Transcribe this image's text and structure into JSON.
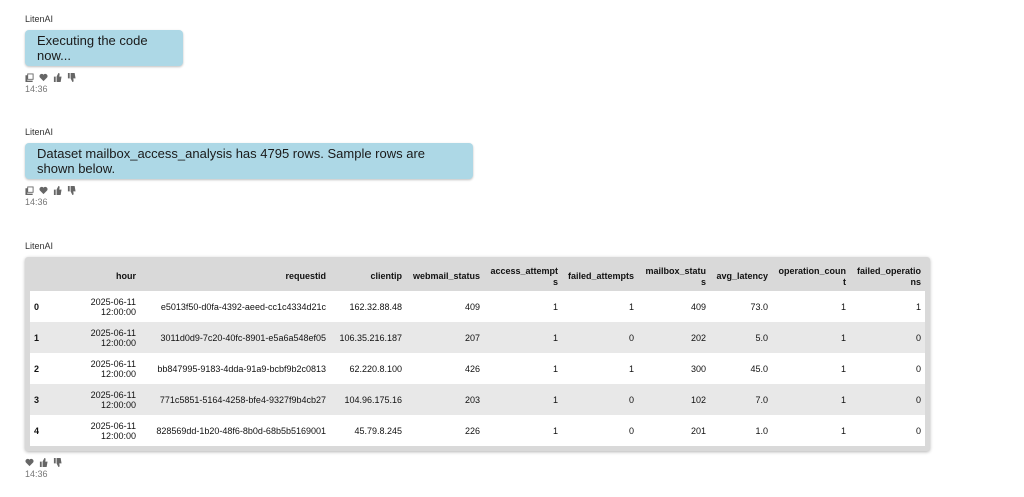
{
  "messages": [
    {
      "sender": "LitenAI",
      "text": "Executing the code now...",
      "time": "14:36"
    },
    {
      "sender": "LitenAI",
      "text": "Dataset mailbox_access_analysis has 4795 rows. Sample rows are shown below.",
      "time": "14:36"
    },
    {
      "sender": "LitenAI",
      "time": "14:36"
    }
  ],
  "table": {
    "columns": [
      "",
      "hour",
      "requestid",
      "clientip",
      "webmail_status",
      "access_attempts",
      "failed_attempts",
      "mailbox_status",
      "avg_latency",
      "operation_count",
      "failed_operations"
    ],
    "rows": [
      [
        "0",
        "2025-06-11 12:00:00",
        "e5013f50-d0fa-4392-aeed-cc1c4334d21c",
        "162.32.88.48",
        "409",
        "1",
        "1",
        "409",
        "73.0",
        "1",
        "1"
      ],
      [
        "1",
        "2025-06-11 12:00:00",
        "3011d0d9-7c20-40fc-8901-e5a6a548ef05",
        "106.35.216.187",
        "207",
        "1",
        "0",
        "202",
        "5.0",
        "1",
        "0"
      ],
      [
        "2",
        "2025-06-11 12:00:00",
        "bb847995-9183-4dda-91a9-bcbf9b2c0813",
        "62.220.8.100",
        "426",
        "1",
        "1",
        "300",
        "45.0",
        "1",
        "0"
      ],
      [
        "3",
        "2025-06-11 12:00:00",
        "771c5851-5164-4258-bfe4-9327f9b4cb27",
        "104.96.175.16",
        "203",
        "1",
        "0",
        "102",
        "7.0",
        "1",
        "0"
      ],
      [
        "4",
        "2025-06-11 12:00:00",
        "828569dd-1b20-48f6-8b0d-68b5b5169001",
        "45.79.8.245",
        "226",
        "1",
        "0",
        "201",
        "1.0",
        "1",
        "0"
      ]
    ]
  },
  "icons": [
    "copy-icon",
    "heart-icon",
    "thumbs-up-icon",
    "thumbs-down-icon"
  ]
}
